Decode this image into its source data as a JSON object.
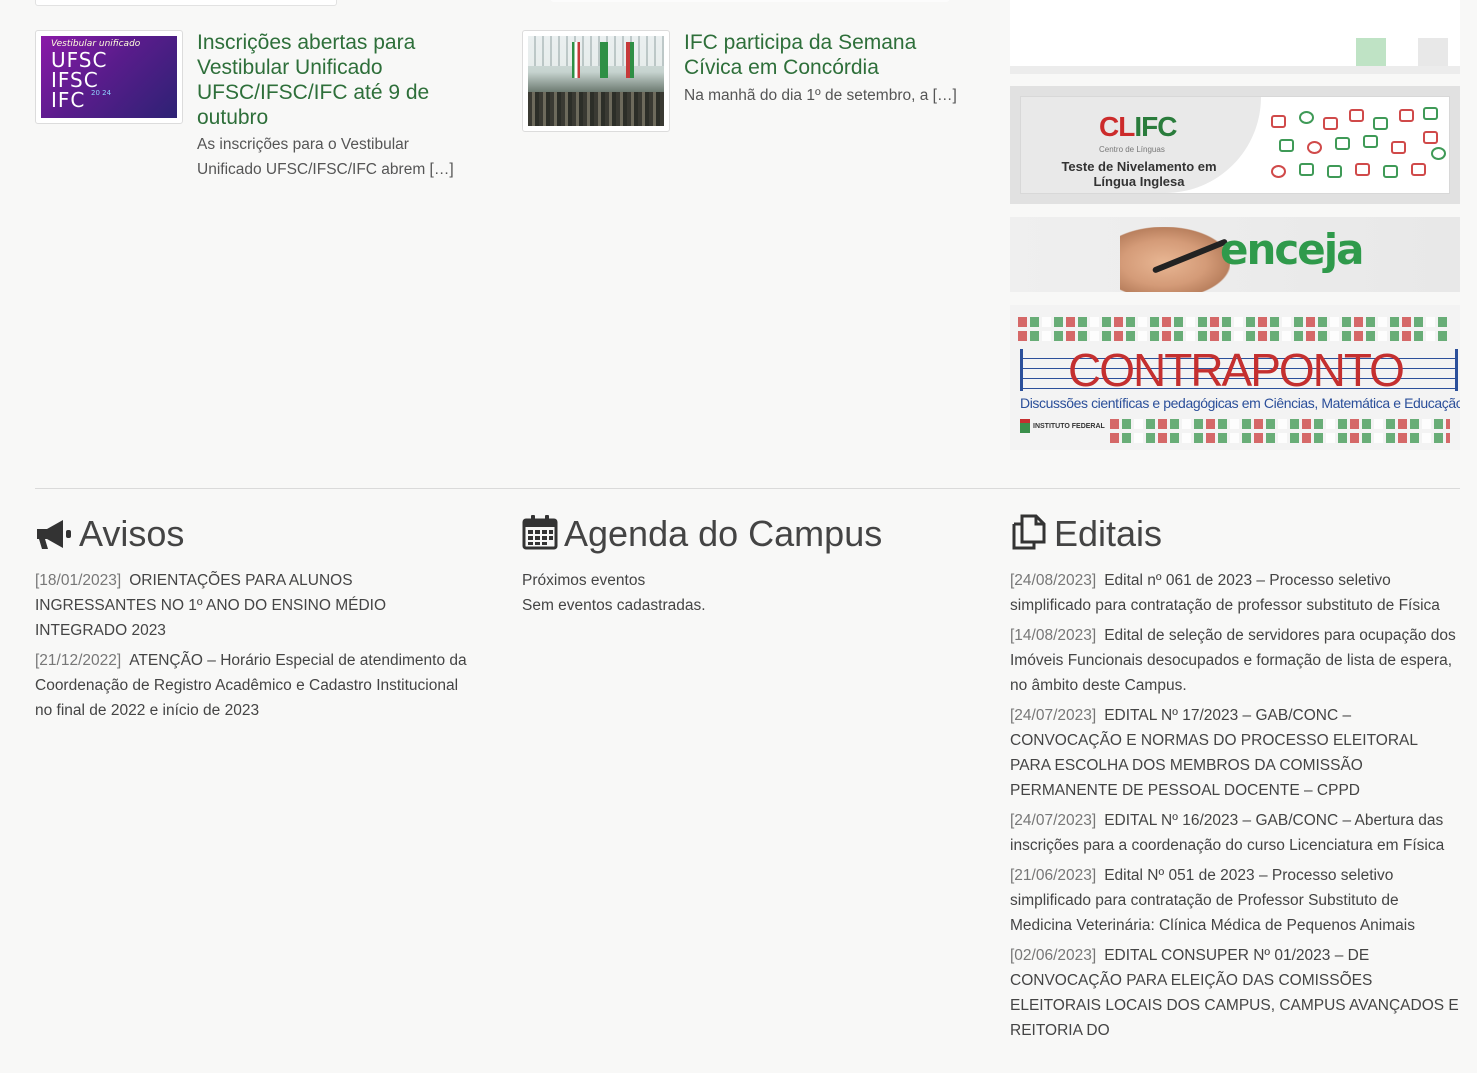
{
  "news": [
    {
      "title": "Inscrições abertas para Vestibular Unificado UFSC/IFSC/IFC até 9 de outubro",
      "excerpt": "As inscrições para o Vestibular Unificado UFSC/IFSC/IFC abrem […]",
      "thumb": {
        "tag": "Vestibular unificado",
        "lines": [
          "UFSC",
          "IFSC",
          "IFC"
        ],
        "year": "20 24"
      }
    },
    {
      "title": "IFC participa da Semana Cívica em Concórdia",
      "excerpt": "Na manhã do dia 1º de setembro, a […]"
    }
  ],
  "banners": {
    "clifc": {
      "logo_c": "CL",
      "logo_ifc": "IFC",
      "subtitle": "Centro de Línguas",
      "text": "Teste de Nivelamento em Língua Inglesa"
    },
    "enceja": {
      "word": "enceja"
    },
    "contraponto": {
      "title": "CONTRAPONTO",
      "subtitle": "Discussões científicas e pedagógicas em Ciências, Matemática e Educação",
      "institute": "INSTITUTO FEDERAL"
    }
  },
  "avisos": {
    "heading": "Avisos",
    "items": [
      {
        "date": "[18/01/2023]",
        "text": "ORIENTAÇÕES PARA ALUNOS INGRESSANTES NO 1º ANO DO ENSINO MÉDIO INTEGRADO 2023"
      },
      {
        "date": "[21/12/2022]",
        "text": "ATENÇÃO – Horário Especial de atendimento da Coordenação de Registro Acadêmico e Cadastro Institucional no final de 2022 e início de 2023"
      }
    ]
  },
  "agenda": {
    "heading": "Agenda do Campus",
    "next": "Próximos eventos",
    "empty": "Sem eventos cadastradas."
  },
  "editais": {
    "heading": "Editais",
    "items": [
      {
        "date": "[24/08/2023]",
        "text": "Edital nº 061 de 2023 – Processo seletivo simplificado para contratação de professor substituto de Física"
      },
      {
        "date": "[14/08/2023]",
        "text": "Edital de seleção de servidores para ocupação dos Imóveis Funcionais desocupados e formação de lista de espera, no âmbito deste Campus."
      },
      {
        "date": "[24/07/2023]",
        "text": "EDITAL Nº 17/2023 – GAB/CONC – CONVOCAÇÃO E NORMAS DO PROCESSO ELEITORAL PARA ESCOLHA DOS MEMBROS DA COMISSÃO PERMANENTE DE PESSOAL DOCENTE – CPPD"
      },
      {
        "date": "[24/07/2023]",
        "text": "EDITAL Nº 16/2023 – GAB/CONC – Abertura das inscrições para a coordenação do curso Licenciatura em Física"
      },
      {
        "date": "[21/06/2023]",
        "text": "Edital Nº 051 de 2023 – Processo seletivo simplificado para contratação de Professor Substituto de Medicina Veterinária: Clínica Médica de Pequenos Animais"
      },
      {
        "date": "[02/06/2023]",
        "text": "EDITAL CONSUPER Nº 01/2023 – DE CONVOCAÇÃO PARA ELEIÇÃO DAS COMISSÕES ELEITORAIS LOCAIS DOS CAMPUS, CAMPUS AVANÇADOS E REITORIA DO"
      }
    ]
  },
  "colors": {
    "link_green": "#2e6f3a",
    "text": "#444444",
    "date": "#777777"
  }
}
